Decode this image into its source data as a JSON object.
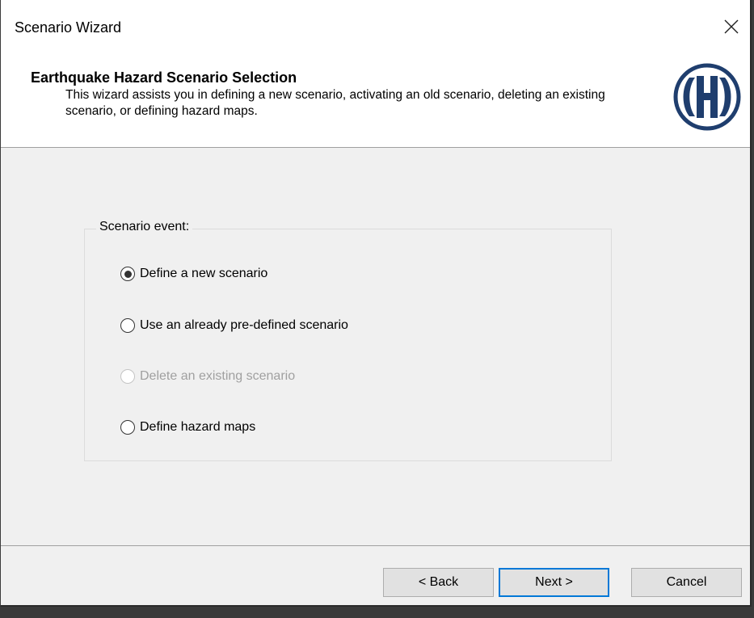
{
  "window": {
    "title": "Scenario Wizard",
    "close_glyph": "✕"
  },
  "header": {
    "title": "Earthquake Hazard Scenario Selection",
    "description": "This wizard assists you in defining a new scenario, activating an old scenario, deleting an existing scenario, or defining hazard maps.",
    "logo_icon": "hazus-h-logo-icon",
    "logo_color": "#1f3e6e"
  },
  "scenario_group": {
    "legend": "Scenario event:",
    "options": [
      {
        "label": "Define a new scenario",
        "selected": true,
        "enabled": true
      },
      {
        "label": "Use an already pre-defined scenario",
        "selected": false,
        "enabled": true
      },
      {
        "label": "Delete an existing scenario",
        "selected": false,
        "enabled": false
      },
      {
        "label": "Define hazard maps",
        "selected": false,
        "enabled": true
      }
    ]
  },
  "buttons": {
    "back": "< Back",
    "next": "Next >",
    "cancel": "Cancel"
  },
  "colors": {
    "accent": "#0078d7",
    "disabled_text": "#a0a0a0"
  }
}
